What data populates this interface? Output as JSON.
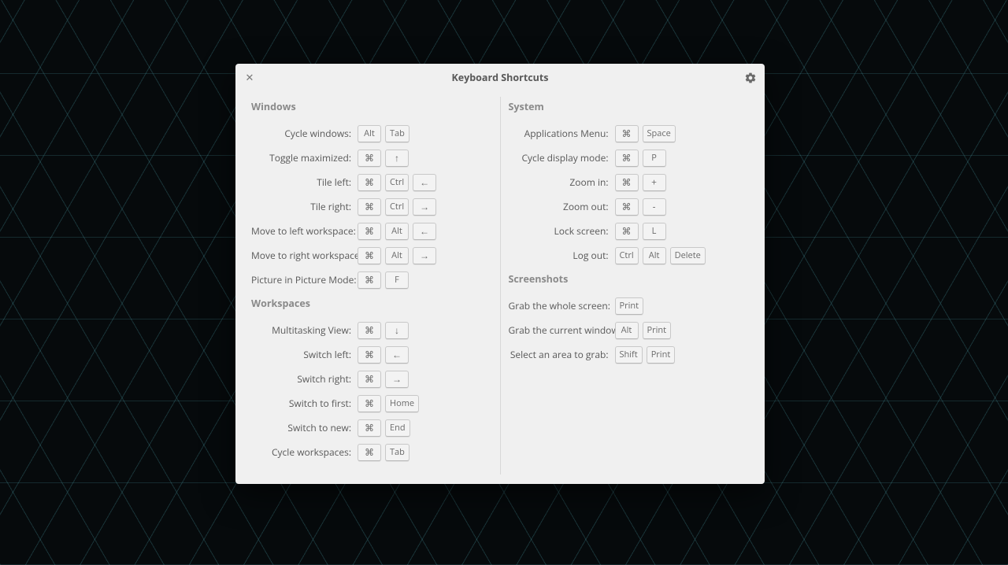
{
  "window": {
    "title": "Keyboard Shortcuts"
  },
  "glyphs": {
    "cmd": "⌘",
    "up": "↑",
    "down": "↓",
    "left": "←",
    "right": "→"
  },
  "left": {
    "section1_title": "Windows",
    "rows1": [
      {
        "label": "Cycle windows:",
        "keys": [
          "Alt",
          "Tab"
        ]
      },
      {
        "label": "Toggle maximized:",
        "keys": [
          "⌘",
          "↑"
        ]
      },
      {
        "label": "Tile left:",
        "keys": [
          "⌘",
          "Ctrl",
          "←"
        ]
      },
      {
        "label": "Tile right:",
        "keys": [
          "⌘",
          "Ctrl",
          "→"
        ]
      },
      {
        "label": "Move to left workspace:",
        "keys": [
          "⌘",
          "Alt",
          "←"
        ]
      },
      {
        "label": "Move to right workspace:",
        "keys": [
          "⌘",
          "Alt",
          "→"
        ]
      },
      {
        "label": "Picture in Picture Mode:",
        "keys": [
          "⌘",
          "F"
        ]
      }
    ],
    "section2_title": "Workspaces",
    "rows2": [
      {
        "label": "Multitasking View:",
        "keys": [
          "⌘",
          "↓"
        ]
      },
      {
        "label": "Switch left:",
        "keys": [
          "⌘",
          "←"
        ]
      },
      {
        "label": "Switch right:",
        "keys": [
          "⌘",
          "→"
        ]
      },
      {
        "label": "Switch to first:",
        "keys": [
          "⌘",
          "Home"
        ]
      },
      {
        "label": "Switch to new:",
        "keys": [
          "⌘",
          "End"
        ]
      },
      {
        "label": "Cycle workspaces:",
        "keys": [
          "⌘",
          "Tab"
        ]
      }
    ]
  },
  "right": {
    "section1_title": "System",
    "rows1": [
      {
        "label": "Applications Menu:",
        "keys": [
          "⌘",
          "Space"
        ]
      },
      {
        "label": "Cycle display mode:",
        "keys": [
          "⌘",
          "P"
        ]
      },
      {
        "label": "Zoom in:",
        "keys": [
          "⌘",
          "+"
        ]
      },
      {
        "label": "Zoom out:",
        "keys": [
          "⌘",
          "-"
        ]
      },
      {
        "label": "Lock screen:",
        "keys": [
          "⌘",
          "L"
        ]
      },
      {
        "label": "Log out:",
        "keys": [
          "Ctrl",
          "Alt",
          "Delete"
        ]
      }
    ],
    "section2_title": "Screenshots",
    "rows2": [
      {
        "label": "Grab the whole screen:",
        "keys": [
          "Print"
        ]
      },
      {
        "label": "Grab the current window:",
        "keys": [
          "Alt",
          "Print"
        ]
      },
      {
        "label": "Select an area to grab:",
        "keys": [
          "Shift",
          "Print"
        ]
      }
    ]
  }
}
